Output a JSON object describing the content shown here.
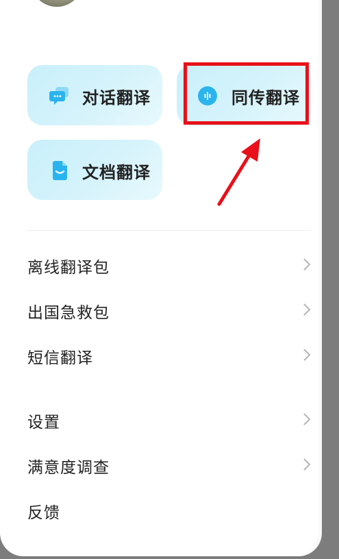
{
  "cards": {
    "dialog": {
      "label": "对话翻译",
      "icon": "chat-bubble-icon"
    },
    "simultaneous": {
      "label": "同传翻译",
      "icon": "microphone-wave-icon"
    },
    "document": {
      "label": "文档翻译",
      "icon": "document-smile-icon"
    }
  },
  "menu": {
    "group1": [
      {
        "label": "离线翻译包"
      },
      {
        "label": "出国急救包"
      },
      {
        "label": "短信翻译"
      }
    ],
    "group2": [
      {
        "label": "设置"
      },
      {
        "label": "满意度调查"
      },
      {
        "label": "反馈"
      }
    ]
  },
  "colors": {
    "accent": "#2ab4ee",
    "card_bg": "#c9f0fb",
    "highlight": "#e8101a",
    "arrow": "#e8101a"
  }
}
